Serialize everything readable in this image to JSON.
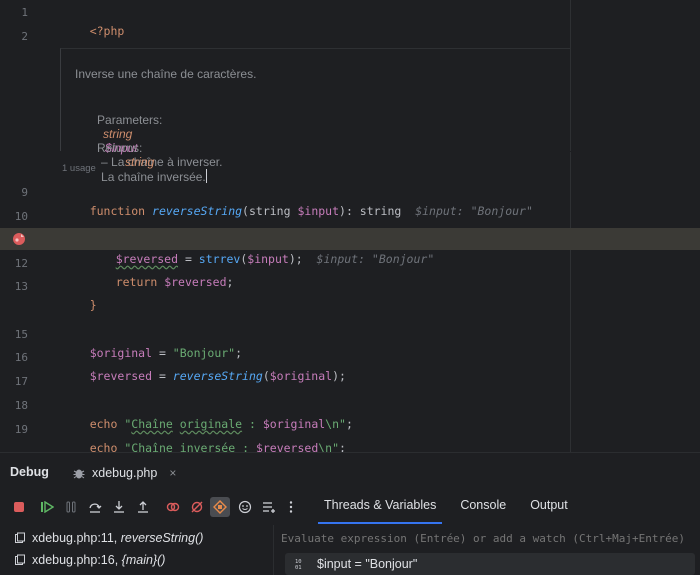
{
  "editor": {
    "line_numbers": [
      "1",
      "2",
      "9",
      "10",
      "12",
      "13",
      "15",
      "16",
      "17",
      "18",
      "19"
    ],
    "line1_tag": "<?php",
    "doc": {
      "summary": "Inverse une chaîne de caractères.",
      "params_label": "Parameters:",
      "param_type": "string",
      "param_name": "$input",
      "param_desc": "– La chaîne à inverser.",
      "returns_label": "Returns:",
      "return_type": "string",
      "return_desc": "La chaîne inversée."
    },
    "usage": "1 usage",
    "l9": {
      "kw": "function",
      "name": "reverseString",
      "open": "(",
      "ptype": "string",
      "pvar": "$input",
      "close": "): string",
      "hint": "$input: \"Bonjour\""
    },
    "l10": "{",
    "l11": {
      "var": "$reversed",
      "eq": " = ",
      "fn": "strrev",
      "open": "(",
      "arg": "$input",
      "close": ");",
      "hint": "$input: \"Bonjour\""
    },
    "l12": {
      "kw": "return",
      "var": "$reversed",
      "semi": ";"
    },
    "l13": "}",
    "l15": {
      "var": "$original",
      "eq": " = ",
      "str": "\"Bonjour\"",
      "semi": ";"
    },
    "l16": {
      "var": "$reversed",
      "eq": " = ",
      "fn": "reverseString",
      "open": "(",
      "arg": "$original",
      "close": ");"
    },
    "l18": {
      "kw": "echo",
      "s1": "\"",
      "w1": "Chaîne",
      "sp": " ",
      "w2": "originale",
      "s2": " : ",
      "var": "$original",
      "s3": "\\n\"",
      "semi": ";"
    },
    "l19": {
      "kw": "echo",
      "s1": "\"",
      "w1": "Chaîne",
      "sp": " ",
      "w2": "inversée",
      "s2": " : ",
      "var": "$reversed",
      "s3": "\\n\"",
      "semi": ";"
    }
  },
  "debug": {
    "title": "Debug",
    "session_tab": "xdebug.php",
    "close": "×",
    "tabs": [
      "Threads & Variables",
      "Console",
      "Output"
    ],
    "frames": [
      {
        "file": "xdebug.php:16, ",
        "func": "{main}()"
      },
      {
        "file": "xdebug.php:11, ",
        "func": "reverseString()"
      }
    ],
    "eval_placeholder": "Evaluate expression (Entrée) or add a watch (Ctrl+Maj+Entrée)",
    "variable": {
      "name": "$input",
      "eq": " = ",
      "value": "\"Bonjour\""
    }
  },
  "colors": {
    "accent": "#3574f0",
    "breakpoint": "#db5c5c",
    "highlight": "#3b3a36"
  }
}
